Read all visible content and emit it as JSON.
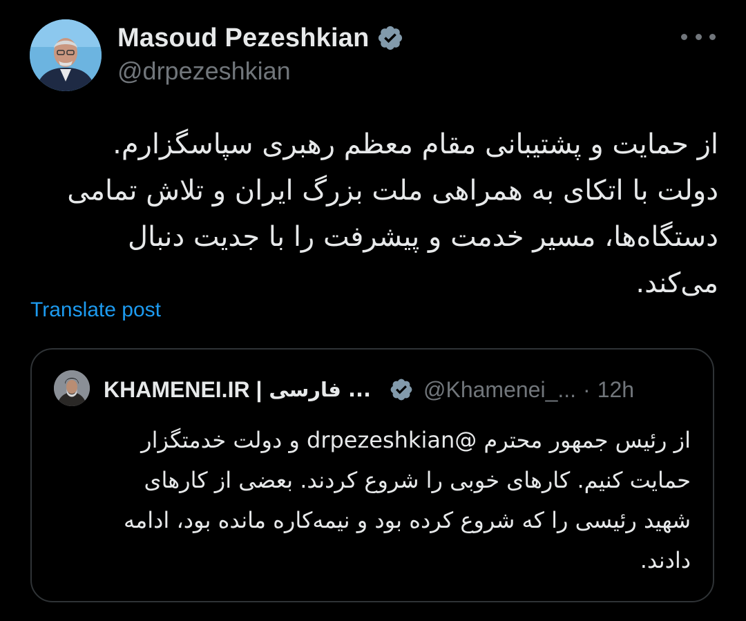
{
  "post": {
    "author_name": "Masoud Pezeshkian",
    "author_handle": "@drpezeshkian",
    "verified_icon": "verified-badge-icon",
    "more_icon": "more-options-icon",
    "text_lines": [
      "از حمایت و پشتیبانی مقام معظم رهبری سپاسگزارم.",
      "دولت با اتکای به همراهی ملت بزرگ ایران و تلاش تمامی",
      "دستگاه‌ها، مسیر خدمت و پیشرفت را با جدیت دنبال",
      "می‌کند."
    ],
    "translate_label": "Translate post"
  },
  "quote": {
    "author_name": "KHAMENEI.IR |",
    "author_name_fa": "فارسی ...",
    "author_handle": "@Khamenei_...",
    "separator": "·",
    "time": "12h",
    "text_lines": [
      "از رئیس جمهور محترم @drpezeshkian  و دولت خدمتگزار",
      "حمایت کنیم. کارهای خوبی را شروع کردند. بعضی از کارهای",
      "شهید رئیسی را که شروع کرده بود و نیمه‌کاره مانده بود، ادامه",
      "دادند."
    ]
  },
  "colors": {
    "background": "#000000",
    "text": "#e7e9ea",
    "secondary": "#71767b",
    "link": "#1d9bf0",
    "verified": "#829aab",
    "border": "#2f3336"
  }
}
